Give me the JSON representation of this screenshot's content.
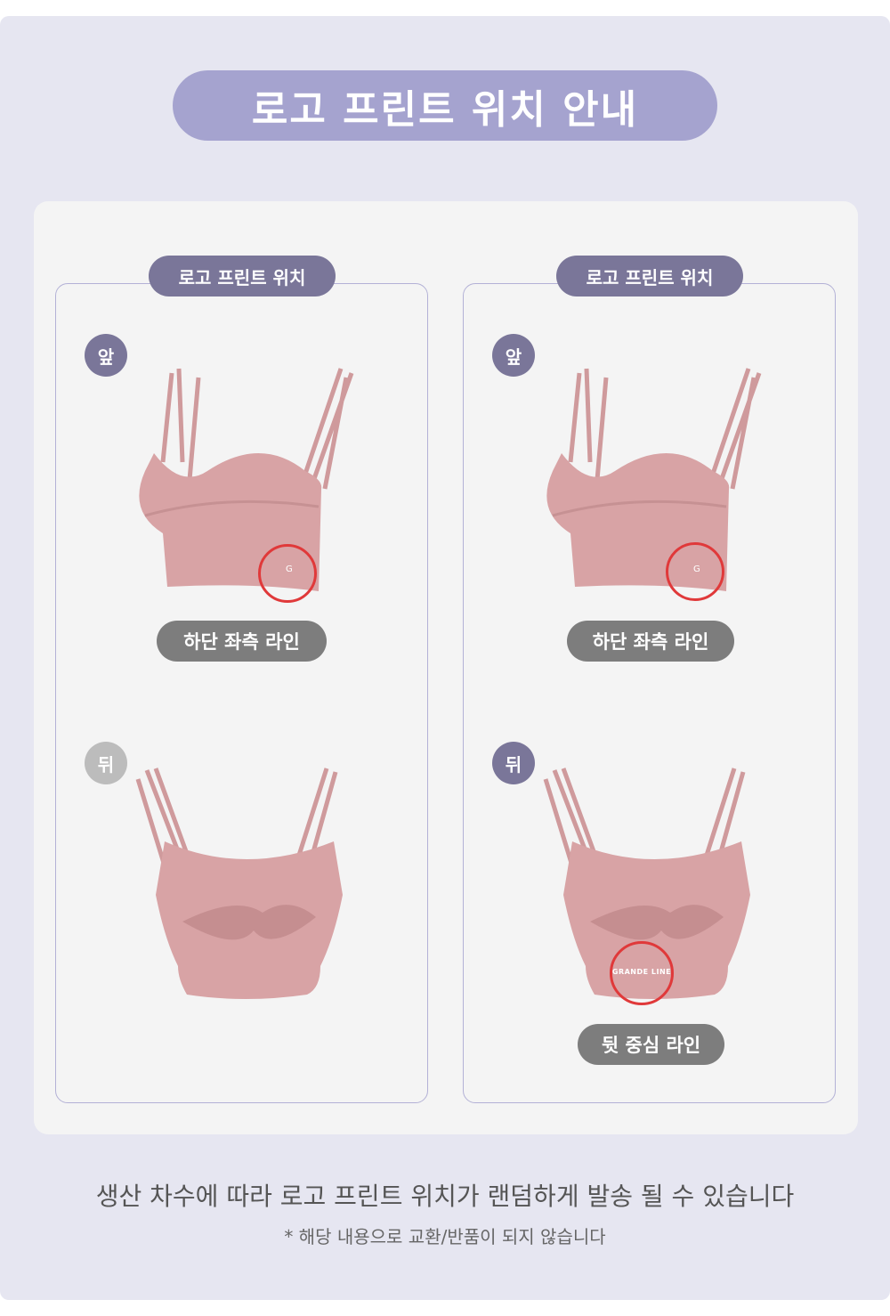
{
  "title": "로고 프린트 위치 안내",
  "colors": {
    "accent_purple": "#7a7699",
    "title_pill": "#a5a3cf",
    "highlight_circle": "#e0393a",
    "garment_pink": "#d8a3a5"
  },
  "panels": [
    {
      "label": "로고 프린트 위치",
      "front_badge": "앞",
      "front_caption": "하단 좌측 라인",
      "back_badge": "뒤",
      "back_caption": ""
    },
    {
      "label": "로고 프린트 위치",
      "front_badge": "앞",
      "front_caption": "하단 좌측 라인",
      "back_badge": "뒤",
      "back_caption": "뒷 중심 라인",
      "back_logo_text": "GRANDE LINE"
    }
  ],
  "notice": {
    "main": "생산 차수에 따라 로고 프린트 위치가 랜덤하게 발송 될 수 있습니다",
    "sub": "* 해당 내용으로 교환/반품이 되지 않습니다"
  }
}
